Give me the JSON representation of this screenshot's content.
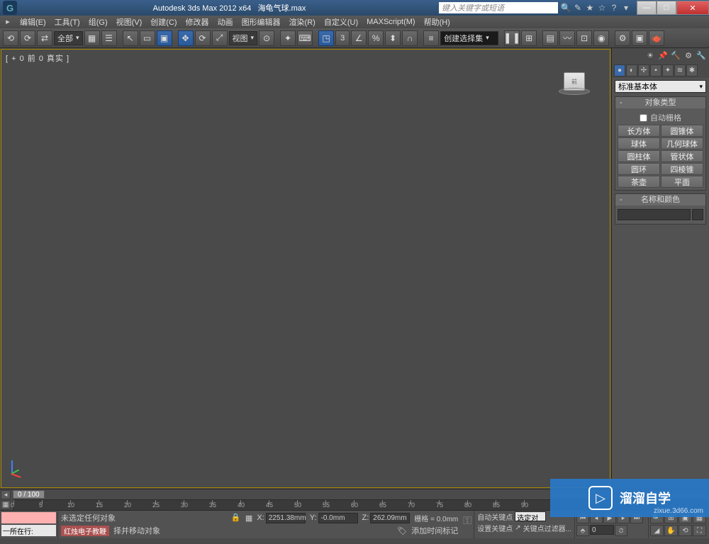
{
  "title": {
    "app": "Autodesk 3ds Max  2012 x64",
    "file": "海龟气球.max"
  },
  "search_placeholder": "键入关键字或短语",
  "menu": [
    "编辑(E)",
    "工具(T)",
    "组(G)",
    "视图(V)",
    "创建(C)",
    "修改器",
    "动画",
    "图形编辑器",
    "渲染(R)",
    "自定义(U)",
    "MAXScript(M)",
    "帮助(H)"
  ],
  "toolbar": {
    "filter_all": "全部",
    "view_label": "视图",
    "three_label": "3",
    "named_set": "创建选择集"
  },
  "viewport": {
    "label": "[ + 0 前 0 真实 ]"
  },
  "panel": {
    "category": "标准基本体",
    "rollout1": "对象类型",
    "auto_grid": "自动栅格",
    "objects": [
      "长方体",
      "圆锥体",
      "球体",
      "几何球体",
      "圆柱体",
      "管状体",
      "圆环",
      "四棱锥",
      "茶壶",
      "平面"
    ],
    "rollout2": "名称和颜色"
  },
  "timeline": {
    "slider": "0 / 100",
    "ticks": [
      0,
      5,
      10,
      15,
      20,
      25,
      30,
      35,
      40,
      45,
      50,
      55,
      60,
      65,
      70,
      75,
      80,
      85,
      90
    ]
  },
  "status": {
    "row_label": "所在行:",
    "no_selection": "未选定任何对象",
    "prompt": "择并移动对象",
    "red_label": "红烛电子教鞭",
    "x_label": "X:",
    "x_val": "2251.38mm",
    "y_label": "Y:",
    "y_val": "-0.0mm",
    "z_label": "Z:",
    "z_val": "262.09mm",
    "grid": "栅格 = 0.0mm",
    "add_marker": "添加时间标记",
    "auto_key": "自动关键点",
    "set_key": "设置关键点",
    "sel_obj": "选定对",
    "key_filter": "关键点过滤器...",
    "frame": "0"
  },
  "watermark": {
    "text": "溜溜自学",
    "url": "zixue.3d66.com",
    "play": "▷"
  }
}
